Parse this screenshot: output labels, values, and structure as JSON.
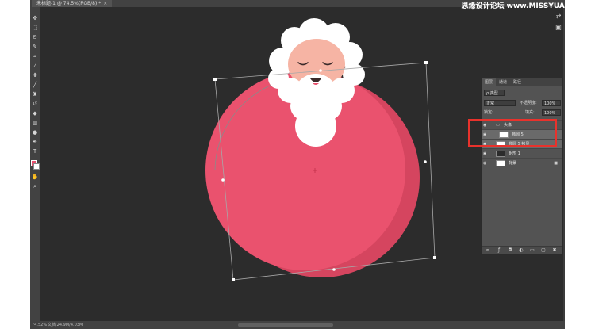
{
  "document": {
    "tab_title": "未标题-1 @ 74.5%(RGB/8) *",
    "tab_close": "×",
    "zoom": "74.52%",
    "doc_info": "文档:24.9M/4.03M"
  },
  "watermark": "思缘设计论坛 www.MISSYUAN.COM",
  "colors": {
    "foreground": "#e8506d",
    "background": "#ffffff",
    "highlight_box": "#e8322c"
  },
  "toolbar": {
    "tools": [
      "move-icon",
      "marquee-icon",
      "lasso-icon",
      "quick-select-icon",
      "crop-icon",
      "eyedropper-icon",
      "healing-brush-icon",
      "brush-icon",
      "clone-stamp-icon",
      "history-brush-icon",
      "eraser-icon",
      "gradient-icon",
      "blur-icon",
      "dodge-icon",
      "pen-icon",
      "text-icon",
      "path-select-icon",
      "shape-icon",
      "hand-icon",
      "zoom-icon",
      "more-icon"
    ],
    "text_tool_glyph": "T"
  },
  "layers_panel": {
    "tabs": [
      "图层",
      "通道",
      "路径"
    ],
    "blend_mode": "正常",
    "opacity_label": "不透明度:",
    "opacity_value": "100%",
    "lock_label": "锁定:",
    "fill_label": "填充:",
    "fill_value": "100%",
    "filter_label": "ρ 类型",
    "layers": [
      {
        "name": "头像",
        "group": true
      },
      {
        "name": "椭圆 5",
        "selected": true
      },
      {
        "name": "椭圆 5 拷贝",
        "selected": true
      },
      {
        "name": "矩形 1"
      },
      {
        "name": "背景",
        "locked": true
      }
    ]
  }
}
